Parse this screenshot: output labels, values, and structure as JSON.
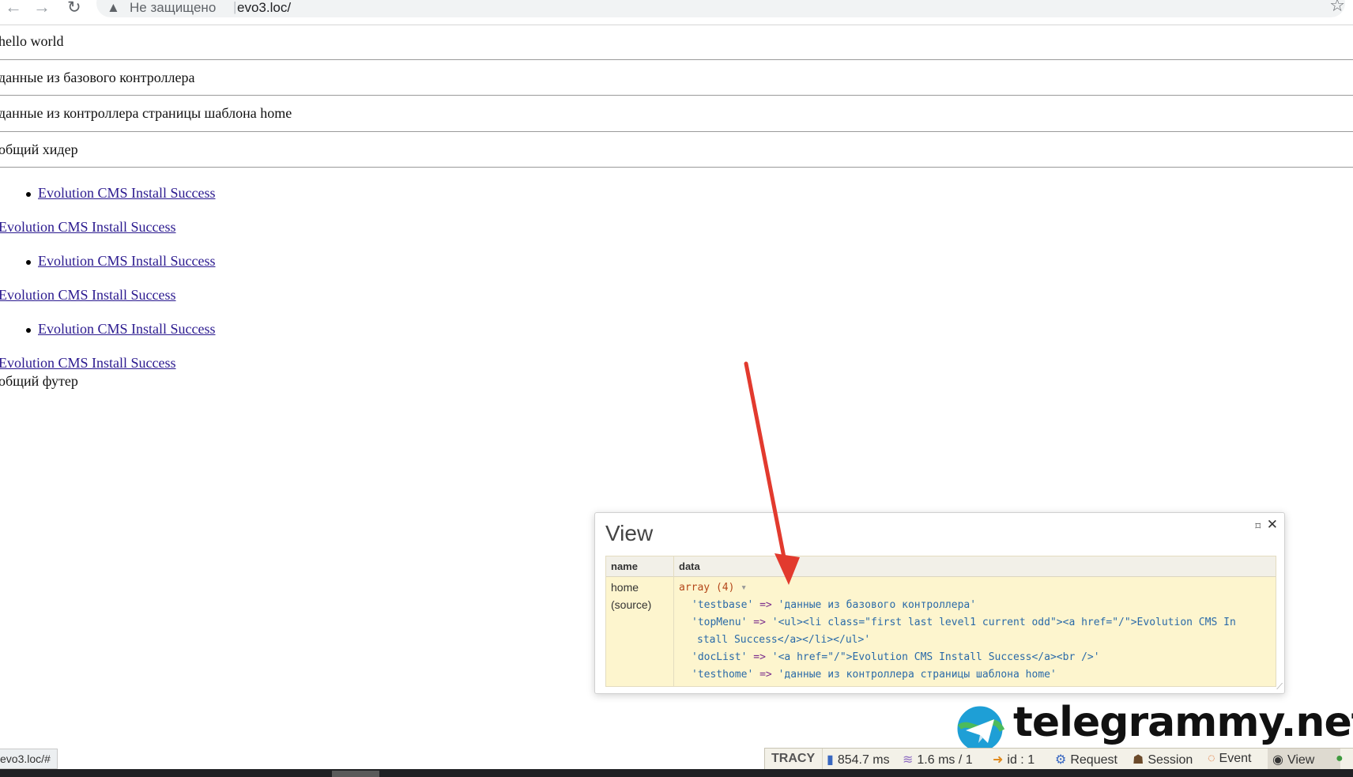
{
  "browser": {
    "security_label": "Не защищено",
    "url": "evo3.loc/",
    "url_separator": "|"
  },
  "page": {
    "line1": "hello world",
    "line2": "данные из базового контроллера",
    "line3": "данные из контроллера страницы шаблона home",
    "header_text": "общий хидер",
    "menu_link_1": "Evolution CMS Install Success",
    "doc_link_1": "Evolution CMS Install Success",
    "menu_link_2": "Evolution CMS Install Success",
    "doc_link_2": "Evolution CMS Install Success",
    "menu_link_3": "Evolution CMS Install Success",
    "doc_link_3": "Evolution CMS Install Success",
    "footer_text": "общий футер"
  },
  "panel": {
    "title": "View",
    "columns": [
      "name",
      "data"
    ],
    "row_name": "home",
    "row_source": "(source)",
    "array_label": "array (4)",
    "entries": [
      {
        "key": "'testbase'",
        "arrow": " => ",
        "value": "'данные из базового контроллера'"
      },
      {
        "key": "'topMenu'",
        "arrow": " => ",
        "value": "'<ul><li class=\"first last level1 current odd\"><a href=\"/\">Evolution CMS In"
      },
      {
        "key": "",
        "arrow": "",
        "value": "stall Success</a></li></ul>'"
      },
      {
        "key": "'docList'",
        "arrow": " => ",
        "value": "'<a href=\"/\">Evolution CMS Install Success</a><br />'"
      },
      {
        "key": "'testhome'",
        "arrow": " => ",
        "value": "'данные из контроллера страницы шаблона home'"
      }
    ]
  },
  "watermark": {
    "text": "telegrammy.net"
  },
  "status": {
    "link_hover": "evo3.loc/#"
  },
  "tracy_bar": {
    "logo": "TRACY",
    "time": "854.7 ms",
    "db": "1.6 ms / 1",
    "id": "id : 1",
    "request": "Request",
    "session": "Session",
    "event": "Event",
    "view": "View"
  },
  "colors": {
    "link": "#2b1a8f",
    "arrow": "#e23a2e",
    "panel_row_bg": "#fdf5ce",
    "tracy_bar_bg": "#f3f1e8"
  }
}
